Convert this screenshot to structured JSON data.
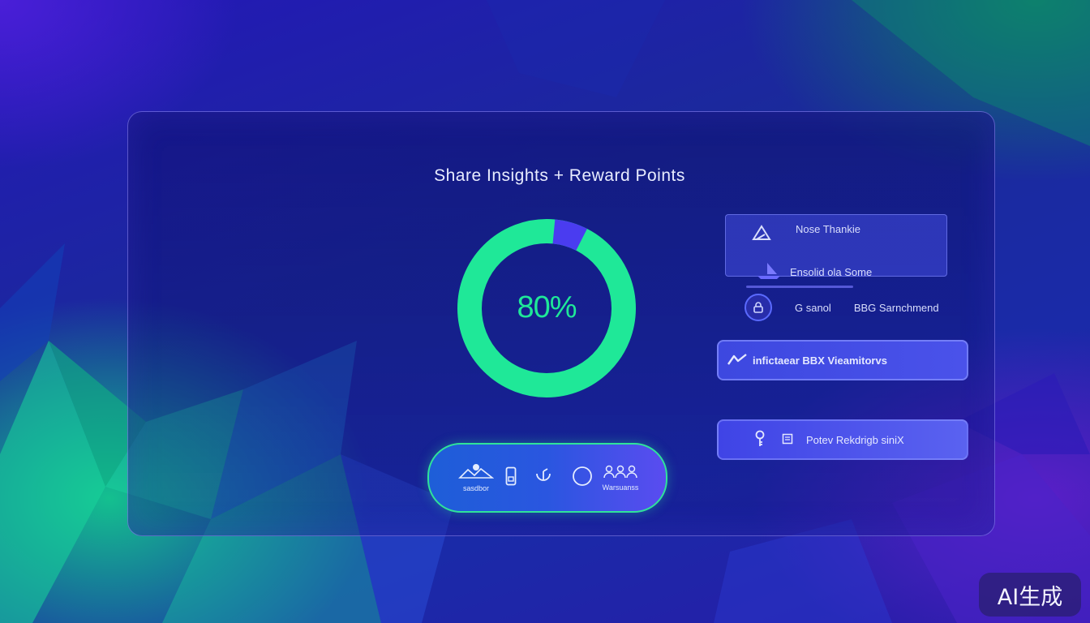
{
  "header": {
    "title": "Share Insights + Reward Points"
  },
  "progress": {
    "display": "80%",
    "value_percent": 80,
    "ring_color": "#1fe898",
    "segment_color": "#4a3cf0"
  },
  "side_list": {
    "card_1": {
      "icon": "triangle-icon",
      "label": "Nose Thankie"
    },
    "row_2": {
      "icon": "sailboat-icon",
      "label": "Ensolid ola Some"
    },
    "row_3": {
      "icon": "lock-icon",
      "label_a": "G sanol",
      "label_b": "BBG Sarnchmend"
    }
  },
  "actions": {
    "bar_1": {
      "icon": "trend-icon",
      "label": "infictaear BBX Vieamitorvs"
    },
    "bar_2": {
      "icon_a": "key-icon",
      "icon_b": "tag-icon",
      "label": "Potev Rekdrigb siniX"
    }
  },
  "pill_nav": {
    "items": [
      {
        "icon": "landscape-icon",
        "caption": "sasdbor"
      },
      {
        "icon": "device-icon",
        "caption": ""
      },
      {
        "icon": "leaf-icon",
        "caption": ""
      },
      {
        "icon": "circle-icon",
        "caption": ""
      },
      {
        "icon": "people-icon",
        "caption": "Warsuanss"
      }
    ]
  },
  "watermark": {
    "label": "AI生成"
  },
  "colors": {
    "accent_green": "#1fe898",
    "accent_blue": "#4a52ea",
    "panel_border": "#968cff"
  }
}
